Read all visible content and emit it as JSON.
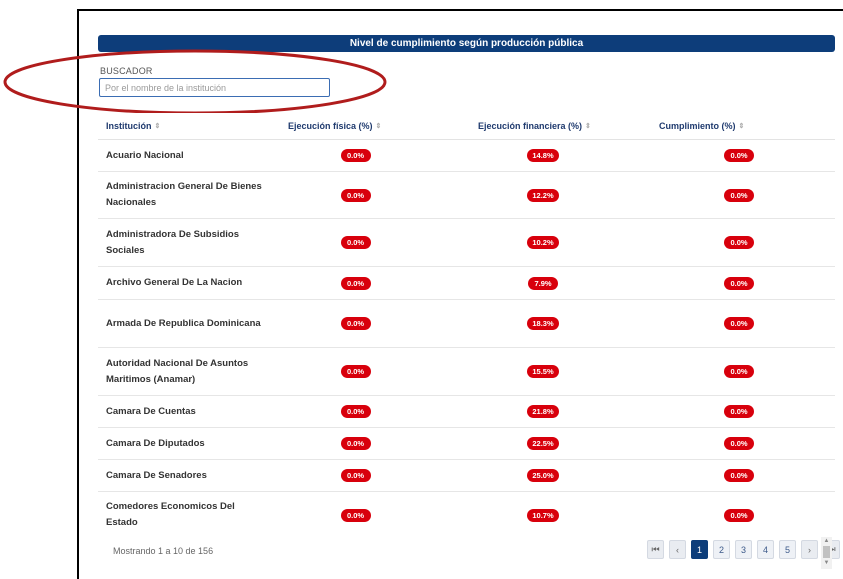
{
  "title": "Nivel de cumplimiento según producción pública",
  "search": {
    "label": "BUSCADOR",
    "placeholder": "Por el nombre de la institución",
    "value": ""
  },
  "table": {
    "headers": [
      "Institución",
      "Ejecución física (%)",
      "Ejecución financiera (%)",
      "Cumplimiento (%)"
    ],
    "rows": [
      {
        "name": "Acuario Nacional",
        "fisica": "0.0%",
        "financiera": "14.8%",
        "cumplimiento": "0.0%"
      },
      {
        "name": "Administracion General De Bienes Nacionales",
        "fisica": "0.0%",
        "financiera": "12.2%",
        "cumplimiento": "0.0%"
      },
      {
        "name": "Administradora De Subsidios Sociales",
        "fisica": "0.0%",
        "financiera": "10.2%",
        "cumplimiento": "0.0%"
      },
      {
        "name": "Archivo General De La Nacion",
        "fisica": "0.0%",
        "financiera": "7.9%",
        "cumplimiento": "0.0%"
      },
      {
        "name": "Armada De Republica Dominicana",
        "fisica": "0.0%",
        "financiera": "18.3%",
        "cumplimiento": "0.0%"
      },
      {
        "name": "Autoridad Nacional De Asuntos Maritimos (Anamar)",
        "fisica": "0.0%",
        "financiera": "15.5%",
        "cumplimiento": "0.0%"
      },
      {
        "name": "Camara De Cuentas",
        "fisica": "0.0%",
        "financiera": "21.8%",
        "cumplimiento": "0.0%"
      },
      {
        "name": "Camara De Diputados",
        "fisica": "0.0%",
        "financiera": "22.5%",
        "cumplimiento": "0.0%"
      },
      {
        "name": "Camara De Senadores",
        "fisica": "0.0%",
        "financiera": "25.0%",
        "cumplimiento": "0.0%"
      },
      {
        "name": "Comedores Economicos Del Estado",
        "fisica": "0.0%",
        "financiera": "10.7%",
        "cumplimiento": "0.0%"
      }
    ]
  },
  "footer": {
    "showing": "Mostrando 1 a 10 de 156"
  },
  "pagination": {
    "first": "⏮",
    "prev": "‹",
    "pages": [
      "1",
      "2",
      "3",
      "4",
      "5"
    ],
    "active_page": "1",
    "next": "›",
    "last": "⏭"
  },
  "colors": {
    "title_bar": "#0d3d7a",
    "badge": "#d8000c",
    "annotation": "#b01c1c"
  },
  "icons": {
    "sort": "sort-icon",
    "annotation": "red-ellipse-annotation"
  }
}
